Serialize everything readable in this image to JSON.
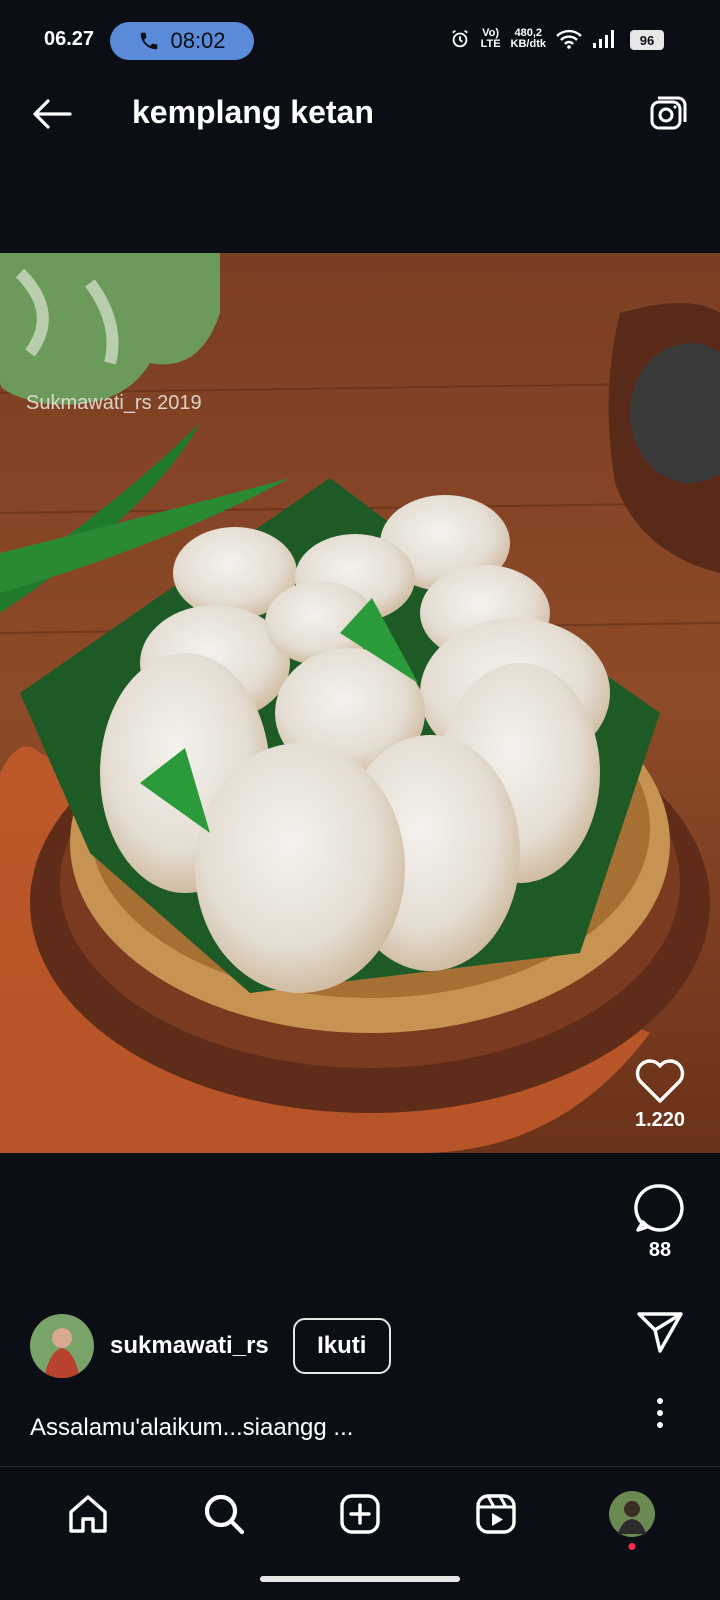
{
  "status_bar": {
    "time": "06.27",
    "call_time": "08:02",
    "network_top": "Vo)",
    "network_bottom": "LTE",
    "speed_top": "480,2",
    "speed_bottom": "KB/dtk",
    "battery": "96"
  },
  "header": {
    "title": "kemplang ketan"
  },
  "post": {
    "watermark": "Sukmawati_rs 2019",
    "likes": "1.220",
    "comments": "88",
    "author": "sukmawati_rs",
    "follow_label": "Ikuti",
    "caption": "Assalamu'alaikum...siaangg ..."
  },
  "nav": {
    "items": [
      "home-icon",
      "search-icon",
      "create-icon",
      "reels-icon",
      "profile-icon"
    ]
  },
  "colors": {
    "background": "#0b0e14",
    "call_pill": "#5b8bd8",
    "notification_dot": "#ff2a4f"
  }
}
